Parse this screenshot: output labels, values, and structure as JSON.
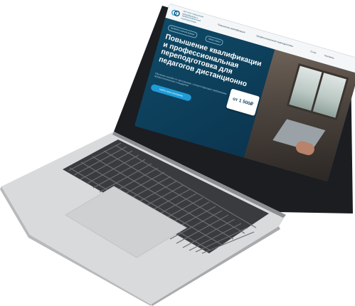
{
  "site": {
    "logo_text": "Институт повышения квалификации и профессиональной переподготовки",
    "nav": [
      "Повышение квалификации",
      "Профессиональная переподготовка",
      "О нас",
      "Контакты"
    ]
  },
  "hero": {
    "chips": [
      "Выберите нужный формат",
      "Набор открыт"
    ],
    "title": "Повышение квалификации и профессиональная переподготовка для педагогов дистанционно",
    "subtitle": "Обучение онлайн по программам, соответствующим требованиям профессиональных стандартов",
    "cta_label": "Найти свою программу",
    "price_badge": "от 1 500₽"
  },
  "colors": {
    "screen_bg": "#0d3d56",
    "accent": "#1f9cd8"
  }
}
